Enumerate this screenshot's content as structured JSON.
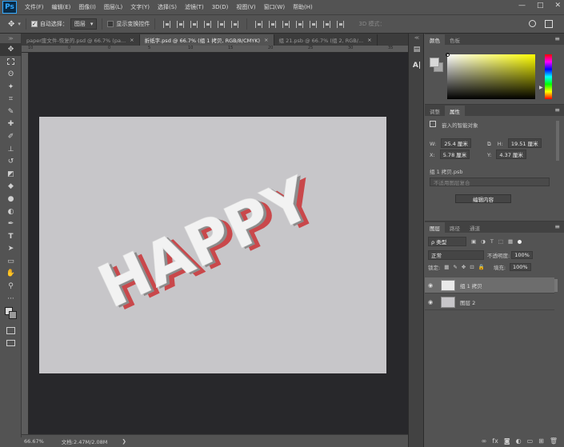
{
  "app": {
    "logo": "Ps"
  },
  "menu": [
    "文件(F)",
    "编辑(E)",
    "图像(I)",
    "图层(L)",
    "文字(Y)",
    "选择(S)",
    "滤镜(T)",
    "3D(D)",
    "视图(V)",
    "窗口(W)",
    "帮助(H)"
  ],
  "window_controls": {
    "minimize": "—",
    "restore": "□",
    "close": "✕"
  },
  "options": {
    "auto_select_label": "自动选择：",
    "auto_select_value": "图层",
    "show_transform_label": "显示变换控件",
    "mode3d_label": "3D 模式：",
    "search_icon": "search-icon",
    "workspace_icon": "workspace-icon"
  },
  "tabs": [
    {
      "label": "paper废文件-恢复的.psd @ 66.7% (pa...",
      "active": false
    },
    {
      "label": "折纸字.psd @ 66.7% (组 1 拷贝, RGB/8/CMYK)",
      "active": true
    },
    {
      "label": "组 21.psb @ 66.7% (组 2, RGB/...",
      "active": false
    }
  ],
  "ruler_top": [
    "10",
    "0",
    "0",
    "5",
    "10",
    "15",
    "20",
    "25",
    "30",
    "35"
  ],
  "status": {
    "zoom": "66.67%",
    "doc": "文档:2.47M/2.08M"
  },
  "color_panel": {
    "tabs": [
      "颜色",
      "色板"
    ],
    "accent": "#ffff00"
  },
  "properties_panel": {
    "tabs": [
      "调整",
      "属性"
    ],
    "type": "嵌入的智能对象",
    "w_label": "W:",
    "w_value": "25.4 厘米",
    "h_label": "H:",
    "h_value": "19.51 厘米",
    "x_label": "X:",
    "x_value": "5.78 厘米",
    "y_label": "Y:",
    "y_value": "4.37 厘米",
    "file": "组 1 拷贝.psb",
    "linked_placeholder": "不适用图层复合",
    "edit_button": "编辑内容"
  },
  "layers_panel": {
    "tabs": [
      "图层",
      "路径",
      "通道"
    ],
    "filter": "ρ 类型",
    "blend_mode": "正常",
    "opacity_label": "不透明度:",
    "opacity_value": "100%",
    "lock_label": "锁定:",
    "fill_label": "填充:",
    "fill_value": "100%",
    "layers": [
      {
        "name": "组 1 拷贝",
        "selected": true
      },
      {
        "name": "图层 2",
        "selected": false
      }
    ]
  },
  "canvas_text": "HAPPY"
}
